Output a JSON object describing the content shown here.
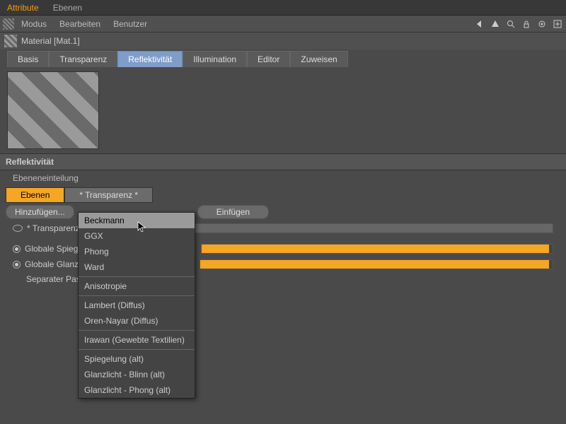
{
  "topTabs": {
    "attribute": "Attribute",
    "ebenen": "Ebenen"
  },
  "menubar": {
    "modus": "Modus",
    "bearbeiten": "Bearbeiten",
    "benutzer": "Benutzer"
  },
  "material": {
    "label": "Material [Mat.1]"
  },
  "channels": {
    "basis": "Basis",
    "transparenz": "Transparenz",
    "reflektivitaet": "Reflektivität",
    "illumination": "Illumination",
    "editor": "Editor",
    "zuweisen": "Zuweisen"
  },
  "section": {
    "reflektivitaet": "Reflektivität",
    "ebeneneinteilung": "Ebeneneinteilung"
  },
  "layerTabs": {
    "ebenen": "Ebenen",
    "transparenz": "* Transparenz *"
  },
  "buttons": {
    "hinzufuegen": "Hinzufügen...",
    "einfuegen": "Einfügen"
  },
  "items": {
    "transparenz": "* Transparenz *"
  },
  "globals": {
    "spiegelung": "Globale Spiegelung",
    "glanzlicht": "Globale Glanzlicht",
    "pass": "Separater Pass",
    "val1": "100 %",
    "val2": "100 %"
  },
  "dropdown": [
    "Beckmann",
    "GGX",
    "Phong",
    "Ward",
    "-",
    "Anisotropie",
    "-",
    "Lambert (Diffus)",
    "Oren-Nayar (Diffus)",
    "-",
    "Irawan (Gewebte Textilien)",
    "-",
    "Spiegelung (alt)",
    "Glanzlicht - Blinn (alt)",
    "Glanzlicht - Phong (alt)"
  ]
}
